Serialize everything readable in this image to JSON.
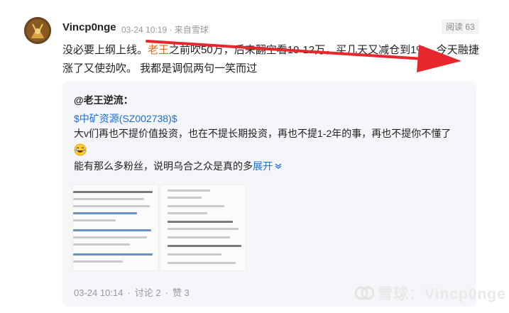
{
  "post": {
    "author": "Vincp0nge",
    "meta": "03-24 10:19 · 来自雪球",
    "views": "阅读 63",
    "text_before": "没必要上纲上线。",
    "mention": "老王",
    "text_after": "之前吹50万，后来翻空看10-12万，买几天又减仓到1%，今天融捷涨了又使劲吹。 我都是调侃两句一笑而过"
  },
  "quote": {
    "author": "@老王逆流：",
    "stock": "$中矿资源(SZ002738)$",
    "line1": "大v们再也不提价值投资，也在不提长期投资，再也不提1-2年的事，再也不提你不懂了",
    "line2": "能有那么多粉丝，说明乌合之众是真的多",
    "expand": "展开",
    "footer_time": "03-24 10:14",
    "footer_comments": "讨论 2",
    "footer_likes": "赞 3"
  },
  "watermark": "雪球：Vincp0nge",
  "colors": {
    "mention": "#e86a17",
    "link": "#1a6cd8",
    "arrow": "#e8262d",
    "quote_bg": "#f4f6f9"
  },
  "icons": [
    "avatar-image",
    "laugh-emoji-icon",
    "expand-chevron-icon",
    "xueqiu-logo-icon"
  ]
}
